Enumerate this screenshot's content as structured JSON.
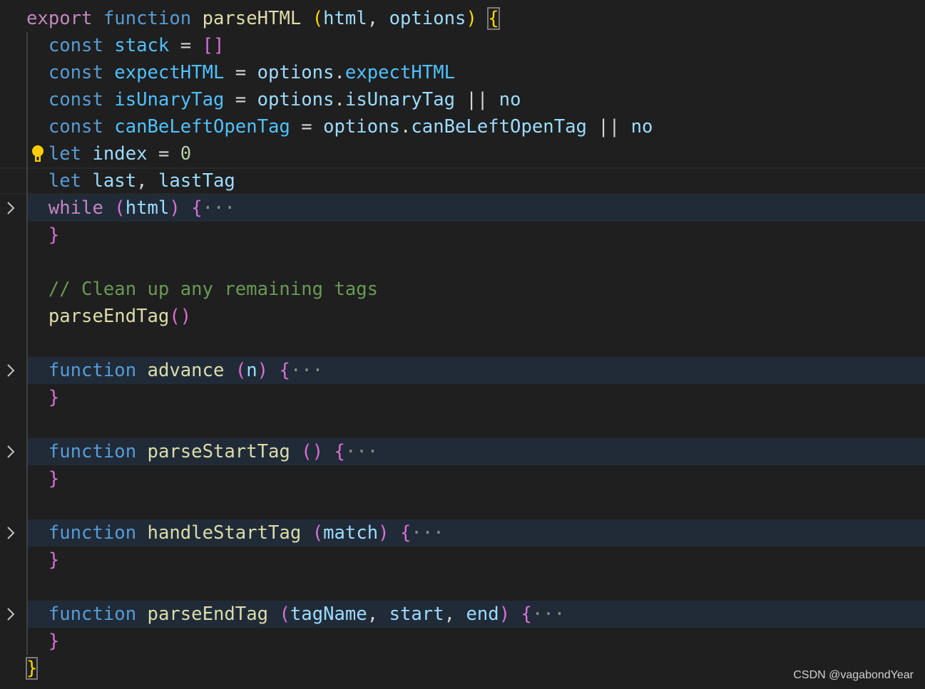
{
  "editor": {
    "colors": {
      "background": "#1f1f1f",
      "folded_line": "#212b38",
      "keyword": "#C586C0",
      "storage": "#569CD6",
      "function": "#DCDCAA",
      "constant": "#4FC1FF",
      "variable": "#9CDCFE",
      "number": "#B5CEA8",
      "comment": "#6A9955",
      "bracket1": "#FFD700",
      "bracket2": "#DA70D6"
    },
    "lines": [
      {
        "indent": 0,
        "tokens": [
          [
            "export",
            "kw"
          ],
          [
            " ",
            "pl"
          ],
          [
            "function",
            "st"
          ],
          [
            " ",
            "pl"
          ],
          [
            "parseHTML",
            "fn"
          ],
          [
            " ",
            "pl"
          ],
          [
            "(",
            "b1"
          ],
          [
            "html",
            "va"
          ],
          [
            ", ",
            "pl"
          ],
          [
            "options",
            "va"
          ],
          [
            "(",
            ""
          ],
          [
            ") ",
            "b1"
          ],
          [
            "{",
            "b1 boxed"
          ]
        ]
      },
      {
        "indent": 1,
        "tokens": [
          [
            "const",
            "st"
          ],
          [
            " ",
            "pl"
          ],
          [
            "stack",
            "cv"
          ],
          [
            " = ",
            "pl"
          ],
          [
            "[]",
            "b2"
          ]
        ]
      },
      {
        "indent": 1,
        "tokens": [
          [
            "const",
            "st"
          ],
          [
            " ",
            "pl"
          ],
          [
            "expectHTML",
            "cv"
          ],
          [
            " = ",
            "pl"
          ],
          [
            "options",
            "va"
          ],
          [
            ".",
            "pl"
          ],
          [
            "expectHTML",
            "cv"
          ]
        ]
      },
      {
        "indent": 1,
        "tokens": [
          [
            "const",
            "st"
          ],
          [
            " ",
            "pl"
          ],
          [
            "isUnaryTag",
            "cv"
          ],
          [
            " = ",
            "pl"
          ],
          [
            "options",
            "va"
          ],
          [
            ".",
            "pl"
          ],
          [
            "isUnaryTag",
            "va"
          ],
          [
            " || ",
            "pl"
          ],
          [
            "no",
            "va"
          ]
        ]
      },
      {
        "indent": 1,
        "tokens": [
          [
            "const",
            "st"
          ],
          [
            " ",
            "pl"
          ],
          [
            "canBeLeftOpenTag",
            "cv"
          ],
          [
            " = ",
            "pl"
          ],
          [
            "options",
            "va"
          ],
          [
            ".",
            "pl"
          ],
          [
            "canBeLeftOpenTag",
            "va"
          ],
          [
            " || ",
            "pl"
          ],
          [
            "no",
            "va"
          ]
        ]
      },
      {
        "indent": 1,
        "bulb": true,
        "tokens": [
          [
            "let",
            "st"
          ],
          [
            " ",
            "pl"
          ],
          [
            "index",
            "va"
          ],
          [
            " = ",
            "pl"
          ],
          [
            "0",
            "nu"
          ]
        ]
      },
      {
        "indent": 1,
        "current": true,
        "tokens": [
          [
            "let",
            "st"
          ],
          [
            " ",
            "pl"
          ],
          [
            "last",
            "va"
          ],
          [
            ", ",
            "pl"
          ],
          [
            "lastTag",
            "va"
          ]
        ]
      },
      {
        "indent": 1,
        "folded": true,
        "tokens": [
          [
            "while",
            "kw"
          ],
          [
            " ",
            "pl"
          ],
          [
            "(",
            "b2"
          ],
          [
            "html",
            "va"
          ],
          [
            ")",
            "b2"
          ],
          [
            " ",
            "pl"
          ],
          [
            "{",
            "b2"
          ],
          [
            "···",
            "el"
          ]
        ]
      },
      {
        "indent": 1,
        "tokens": [
          [
            "}",
            "b2"
          ]
        ]
      },
      {
        "indent": 0,
        "guide": true,
        "tokens": []
      },
      {
        "indent": 1,
        "tokens": [
          [
            "// Clean up any remaining tags",
            "cm"
          ]
        ]
      },
      {
        "indent": 1,
        "tokens": [
          [
            "parseEndTag",
            "fn"
          ],
          [
            "()",
            "b2"
          ]
        ]
      },
      {
        "indent": 0,
        "guide": true,
        "tokens": []
      },
      {
        "indent": 1,
        "folded": true,
        "tokens": [
          [
            "function",
            "st"
          ],
          [
            " ",
            "pl"
          ],
          [
            "advance",
            "fn"
          ],
          [
            " ",
            "pl"
          ],
          [
            "(",
            "b2"
          ],
          [
            "n",
            "va"
          ],
          [
            ")",
            "b2"
          ],
          [
            " ",
            "pl"
          ],
          [
            "{",
            "b2"
          ],
          [
            "···",
            "el"
          ]
        ]
      },
      {
        "indent": 1,
        "tokens": [
          [
            "}",
            "b2"
          ]
        ]
      },
      {
        "indent": 0,
        "guide": true,
        "tokens": []
      },
      {
        "indent": 1,
        "folded": true,
        "tokens": [
          [
            "function",
            "st"
          ],
          [
            " ",
            "pl"
          ],
          [
            "parseStartTag",
            "fn"
          ],
          [
            " ",
            "pl"
          ],
          [
            "()",
            "b2"
          ],
          [
            " ",
            "pl"
          ],
          [
            "{",
            "b2"
          ],
          [
            "···",
            "el"
          ]
        ]
      },
      {
        "indent": 1,
        "tokens": [
          [
            "}",
            "b2"
          ]
        ]
      },
      {
        "indent": 0,
        "guide": true,
        "tokens": []
      },
      {
        "indent": 1,
        "folded": true,
        "tokens": [
          [
            "function",
            "st"
          ],
          [
            " ",
            "pl"
          ],
          [
            "handleStartTag",
            "fn"
          ],
          [
            " ",
            "pl"
          ],
          [
            "(",
            "b2"
          ],
          [
            "match",
            "va"
          ],
          [
            ")",
            "b2"
          ],
          [
            " ",
            "pl"
          ],
          [
            "{",
            "b2"
          ],
          [
            "···",
            "el"
          ]
        ]
      },
      {
        "indent": 1,
        "tokens": [
          [
            "}",
            "b2"
          ]
        ]
      },
      {
        "indent": 0,
        "guide": true,
        "tokens": []
      },
      {
        "indent": 1,
        "folded": true,
        "tokens": [
          [
            "function",
            "st"
          ],
          [
            " ",
            "pl"
          ],
          [
            "parseEndTag",
            "fn"
          ],
          [
            " ",
            "pl"
          ],
          [
            "(",
            "b2"
          ],
          [
            "tagName",
            "va"
          ],
          [
            ", ",
            "pl"
          ],
          [
            "start",
            "va"
          ],
          [
            ", ",
            "pl"
          ],
          [
            "end",
            "va"
          ],
          [
            ")",
            "b2"
          ],
          [
            " ",
            "pl"
          ],
          [
            "{",
            "b2"
          ],
          [
            "···",
            "el"
          ]
        ]
      },
      {
        "indent": 1,
        "tokens": [
          [
            "}",
            "b2"
          ]
        ]
      },
      {
        "indent": 0,
        "tokens": [
          [
            "}",
            "b1 boxed"
          ]
        ]
      }
    ]
  },
  "watermark": "CSDN @vagabondYear"
}
